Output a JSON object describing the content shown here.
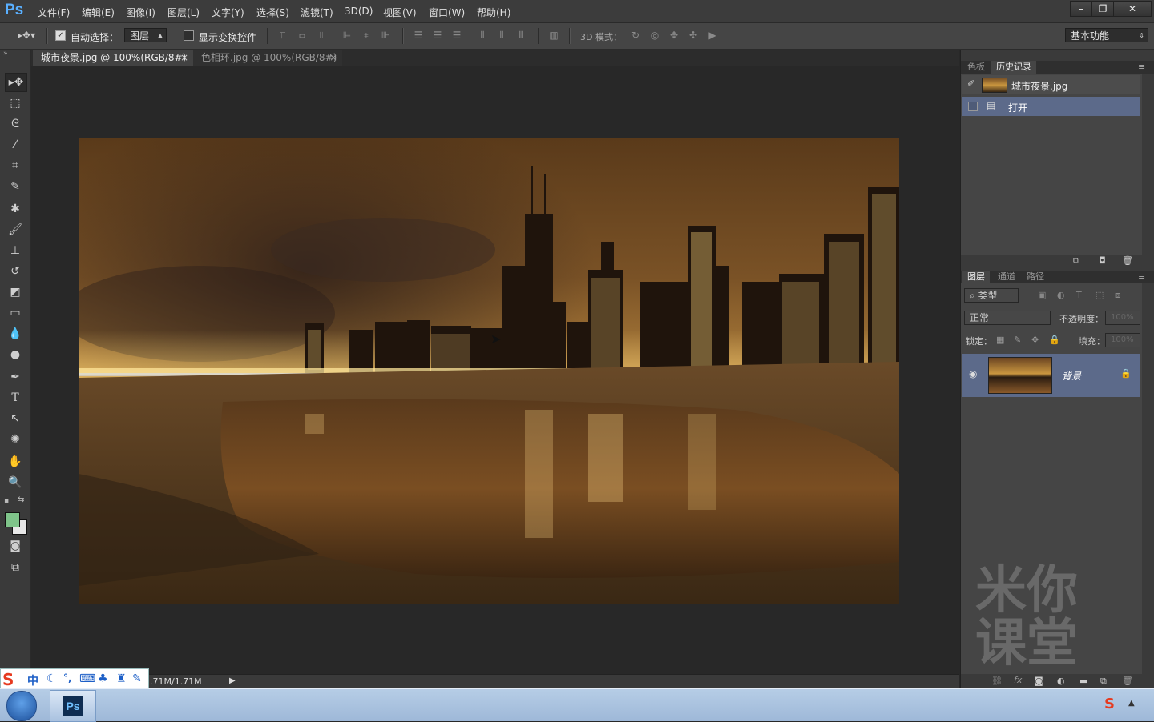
{
  "app": {
    "logo": "Ps"
  },
  "menu": [
    "文件(F)",
    "编辑(E)",
    "图像(I)",
    "图层(L)",
    "文字(Y)",
    "选择(S)",
    "滤镜(T)",
    "3D(D)",
    "视图(V)",
    "窗口(W)",
    "帮助(H)"
  ],
  "window_controls": {
    "minimize": "–",
    "restore": "❐",
    "close": "✕"
  },
  "options": {
    "auto_select_label": "自动选择：",
    "auto_select_checked": true,
    "auto_select_target": "图层",
    "show_transform_label": "显示变换控件",
    "mode_3d_label": "3D 模式：",
    "workspace": "基本功能"
  },
  "tabs": [
    {
      "label": "城市夜景.jpg @ 100%(RGB/8#)",
      "close": "×",
      "active": true
    },
    {
      "label": "色相环.jpg @ 100%(RGB/8#)",
      "close": "×",
      "active": false
    }
  ],
  "status": {
    "doc_size": ".71M/1.71M"
  },
  "history_panel": {
    "tabs": [
      "色板",
      "历史记录"
    ],
    "active_tab": "历史记录",
    "snapshot": "城市夜景.jpg",
    "steps": [
      "打开"
    ]
  },
  "layers_panel": {
    "tabs": [
      "图层",
      "通道",
      "路径"
    ],
    "active_tab": "图层",
    "filter_kind": "类型",
    "blend_mode": "正常",
    "opacity_label": "不透明度：",
    "opacity": "100%",
    "lock_label": "锁定：",
    "fill_label": "填充：",
    "fill": "100%",
    "layers": [
      {
        "name": "背景",
        "locked": true,
        "visible": true
      }
    ]
  },
  "watermark": {
    "line1": "米你",
    "line2": "课堂"
  },
  "taskbar": {
    "ps_label": "Ps",
    "ime_lang": "中",
    "ime_logo": "S"
  },
  "colors": {
    "foreground": "#7fc48a",
    "background": "#e8e8e8",
    "accent": "#5ab0ff"
  }
}
